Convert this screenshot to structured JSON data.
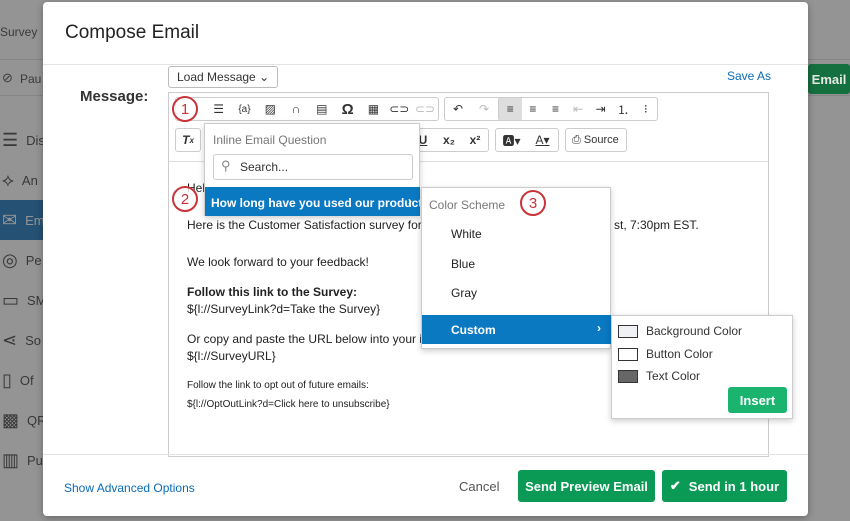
{
  "background": {
    "top_title": "Survey",
    "pause_label": "Pau",
    "email_button": "Email",
    "sidebar": [
      {
        "label": "Dis",
        "icon": "list-icon"
      },
      {
        "label": "An",
        "icon": "link-icon"
      },
      {
        "label": "Em",
        "icon": "envelope-icon",
        "active": true
      },
      {
        "label": "Pe",
        "icon": "fingerprint-icon"
      },
      {
        "label": "SM",
        "icon": "chat-icon"
      },
      {
        "label": "So",
        "icon": "share-icon"
      },
      {
        "label": "Of",
        "icon": "tablet-icon"
      },
      {
        "label": "QR",
        "icon": "qr-code-icon"
      },
      {
        "label": "Pu",
        "icon": "panel-icon"
      }
    ]
  },
  "modal": {
    "title": "Compose Email",
    "message_label": "Message:",
    "load_message": "Load Message",
    "save_as": "Save As",
    "source_label": "Source",
    "body": {
      "line1": "Hel",
      "line2a": "Here is the Customer Satisfaction survey for C",
      "line2b": "st, 7:30pm EST.",
      "line3": "We look forward to your feedback!",
      "line4": "Follow this link to the Survey:",
      "line5": "${l://SurveyLink?d=Take the Survey}",
      "line6": "Or copy and paste the URL below into your in",
      "line7": "${l://SurveyURL}",
      "line8": "Follow the link to opt out of future emails:",
      "line9": "${l://OptOutLink?d=Click here to unsubscribe}"
    },
    "inline_menu": {
      "header": "Inline Email Question",
      "search_placeholder": "Search...",
      "selected_item": "How long have you used our product"
    },
    "color_menu": {
      "header": "Color Scheme",
      "items": [
        "White",
        "Blue",
        "Gray"
      ],
      "selected": "Custom"
    },
    "custom_menu": {
      "items": [
        {
          "label": "Background Color",
          "color": "#f0f1f5"
        },
        {
          "label": "Button Color",
          "color": "#ffffff"
        },
        {
          "label": "Text Color",
          "color": "#666666"
        }
      ],
      "insert": "Insert"
    },
    "callouts": [
      "1",
      "2",
      "3"
    ],
    "footer": {
      "advanced": "Show Advanced Options",
      "cancel": "Cancel",
      "preview": "Send Preview Email",
      "send": "Send in 1 hour"
    }
  }
}
